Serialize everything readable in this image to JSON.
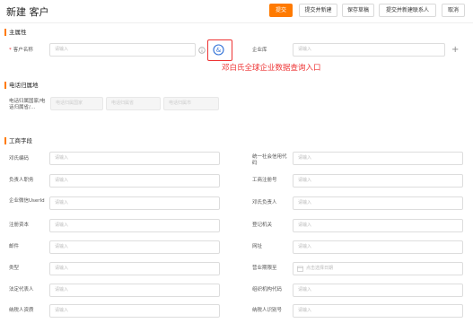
{
  "header": {
    "title": "新建 客户",
    "buttons": {
      "submit": "提交",
      "submit_new": "提交并新建",
      "save_draft": "保存草稿",
      "submit_new_contact": "提交并新建联系人",
      "cancel": "取消"
    }
  },
  "main_section": {
    "title": "主属性",
    "customer_name_label": "客户名称",
    "customer_name_placeholder": "请输入",
    "enterprise_db_label": "企业库",
    "enterprise_db_placeholder": "请输入",
    "annotation": "邓白氏全球企业数据查询入口"
  },
  "phone_section": {
    "title": "电话归属地",
    "label": "电话归属国家/电话归属省/...",
    "select1": "电话归属国家",
    "select2": "电话归属省",
    "select3": "电话归属市"
  },
  "business_section": {
    "title": "工商字段",
    "left_fields": [
      {
        "label": "邓氏编码",
        "placeholder": "请输入"
      },
      {
        "label": "负责人职务",
        "placeholder": "请输入"
      },
      {
        "label": "企业微信UserId",
        "placeholder": "请输入"
      },
      {
        "label": "注册资本",
        "placeholder": "请输入"
      },
      {
        "label": "邮件",
        "placeholder": "请输入"
      },
      {
        "label": "类型",
        "placeholder": "请输入"
      },
      {
        "label": "法定代表人",
        "placeholder": "请输入"
      },
      {
        "label": "纳税人资质",
        "placeholder": "请输入"
      }
    ],
    "right_fields": [
      {
        "label": "统一社会信用代码",
        "placeholder": "请输入"
      },
      {
        "label": "工商注册号",
        "placeholder": "请输入"
      },
      {
        "label": "邓氏负责人",
        "placeholder": "请输入"
      },
      {
        "label": "登记机关",
        "placeholder": "请输入"
      },
      {
        "label": "网址",
        "placeholder": "请输入"
      },
      {
        "label": "营业期限至",
        "placeholder": "点击选择日期"
      },
      {
        "label": "组织机构代码",
        "placeholder": "请输入"
      },
      {
        "label": "纳税人识别号",
        "placeholder": "请输入"
      }
    ]
  },
  "colors": {
    "accent": "#ff7a00",
    "annotation": "#e33333"
  }
}
